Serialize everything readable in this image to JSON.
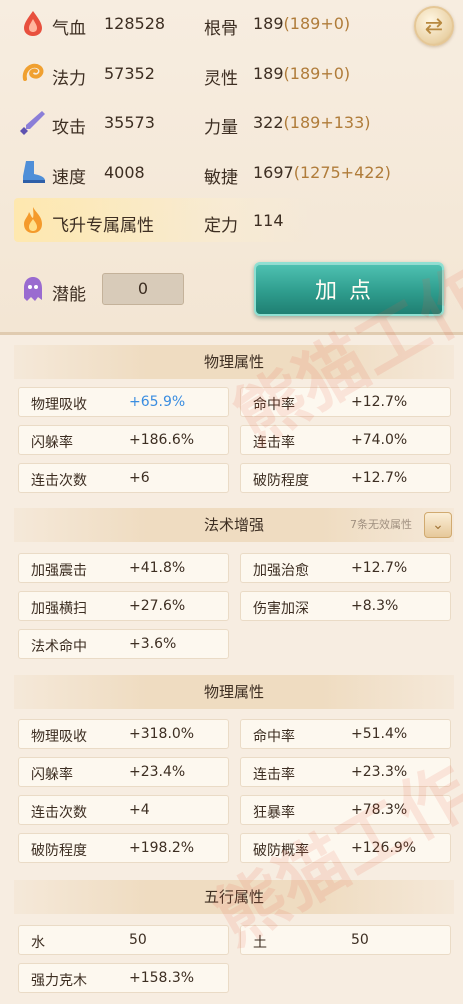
{
  "stats": {
    "hp": {
      "label": "气血",
      "value": "128528"
    },
    "bone": {
      "label": "根骨",
      "value": "189",
      "detail": "(189+0)"
    },
    "mana": {
      "label": "法力",
      "value": "57352"
    },
    "spirit": {
      "label": "灵性",
      "value": "189",
      "detail": "(189+0)"
    },
    "attack": {
      "label": "攻击",
      "value": "35573"
    },
    "strength": {
      "label": "力量",
      "value": "322",
      "detail": "(189+133)"
    },
    "speed": {
      "label": "速度",
      "value": "4008"
    },
    "agility": {
      "label": "敏捷",
      "value": "1697",
      "detail": "(1275+422)"
    },
    "ascension": {
      "label": "飞升专属属性"
    },
    "focus": {
      "label": "定力",
      "value": "114"
    },
    "potential": {
      "label": "潜能",
      "value": "0"
    }
  },
  "buttons": {
    "add_point": "加点",
    "swap_icon": "swap-icon"
  },
  "sections": {
    "physical1": {
      "title": "物理属性",
      "cells": [
        {
          "label": "物理吸收",
          "value": "+65.9%"
        },
        {
          "label": "命中率",
          "value": "+12.7%"
        },
        {
          "label": "闪躲率",
          "value": "+186.6%"
        },
        {
          "label": "连击率",
          "value": "+74.0%"
        },
        {
          "label": "连击次数",
          "value": "+6"
        },
        {
          "label": "破防程度",
          "value": "+12.7%"
        }
      ]
    },
    "magic": {
      "title": "法术增强",
      "extra": "7条无效属性",
      "cells": [
        {
          "label": "加强震击",
          "value": "+41.8%"
        },
        {
          "label": "加强治愈",
          "value": "+12.7%"
        },
        {
          "label": "加强横扫",
          "value": "+27.6%"
        },
        {
          "label": "伤害加深",
          "value": "+8.3%"
        },
        {
          "label": "法术命中",
          "value": "+3.6%"
        }
      ]
    },
    "physical2": {
      "title": "物理属性",
      "cells": [
        {
          "label": "物理吸收",
          "value": "+318.0%"
        },
        {
          "label": "命中率",
          "value": "+51.4%"
        },
        {
          "label": "闪躲率",
          "value": "+23.4%"
        },
        {
          "label": "连击率",
          "value": "+23.3%"
        },
        {
          "label": "连击次数",
          "value": "+4"
        },
        {
          "label": "狂暴率",
          "value": "+78.3%"
        },
        {
          "label": "破防程度",
          "value": "+198.2%"
        },
        {
          "label": "破防概率",
          "value": "+126.9%"
        }
      ]
    },
    "elements": {
      "title": "五行属性",
      "cells": [
        {
          "label": "水",
          "value": "50"
        },
        {
          "label": "土",
          "value": "50"
        },
        {
          "label": "强力克木",
          "value": "+158.3%"
        }
      ]
    }
  },
  "watermark": "熊猫工作",
  "colors": {
    "highlight_blue": "#3a8de0",
    "bonus_brown": "#b07c3a",
    "button_teal": "#2f9d8e"
  }
}
